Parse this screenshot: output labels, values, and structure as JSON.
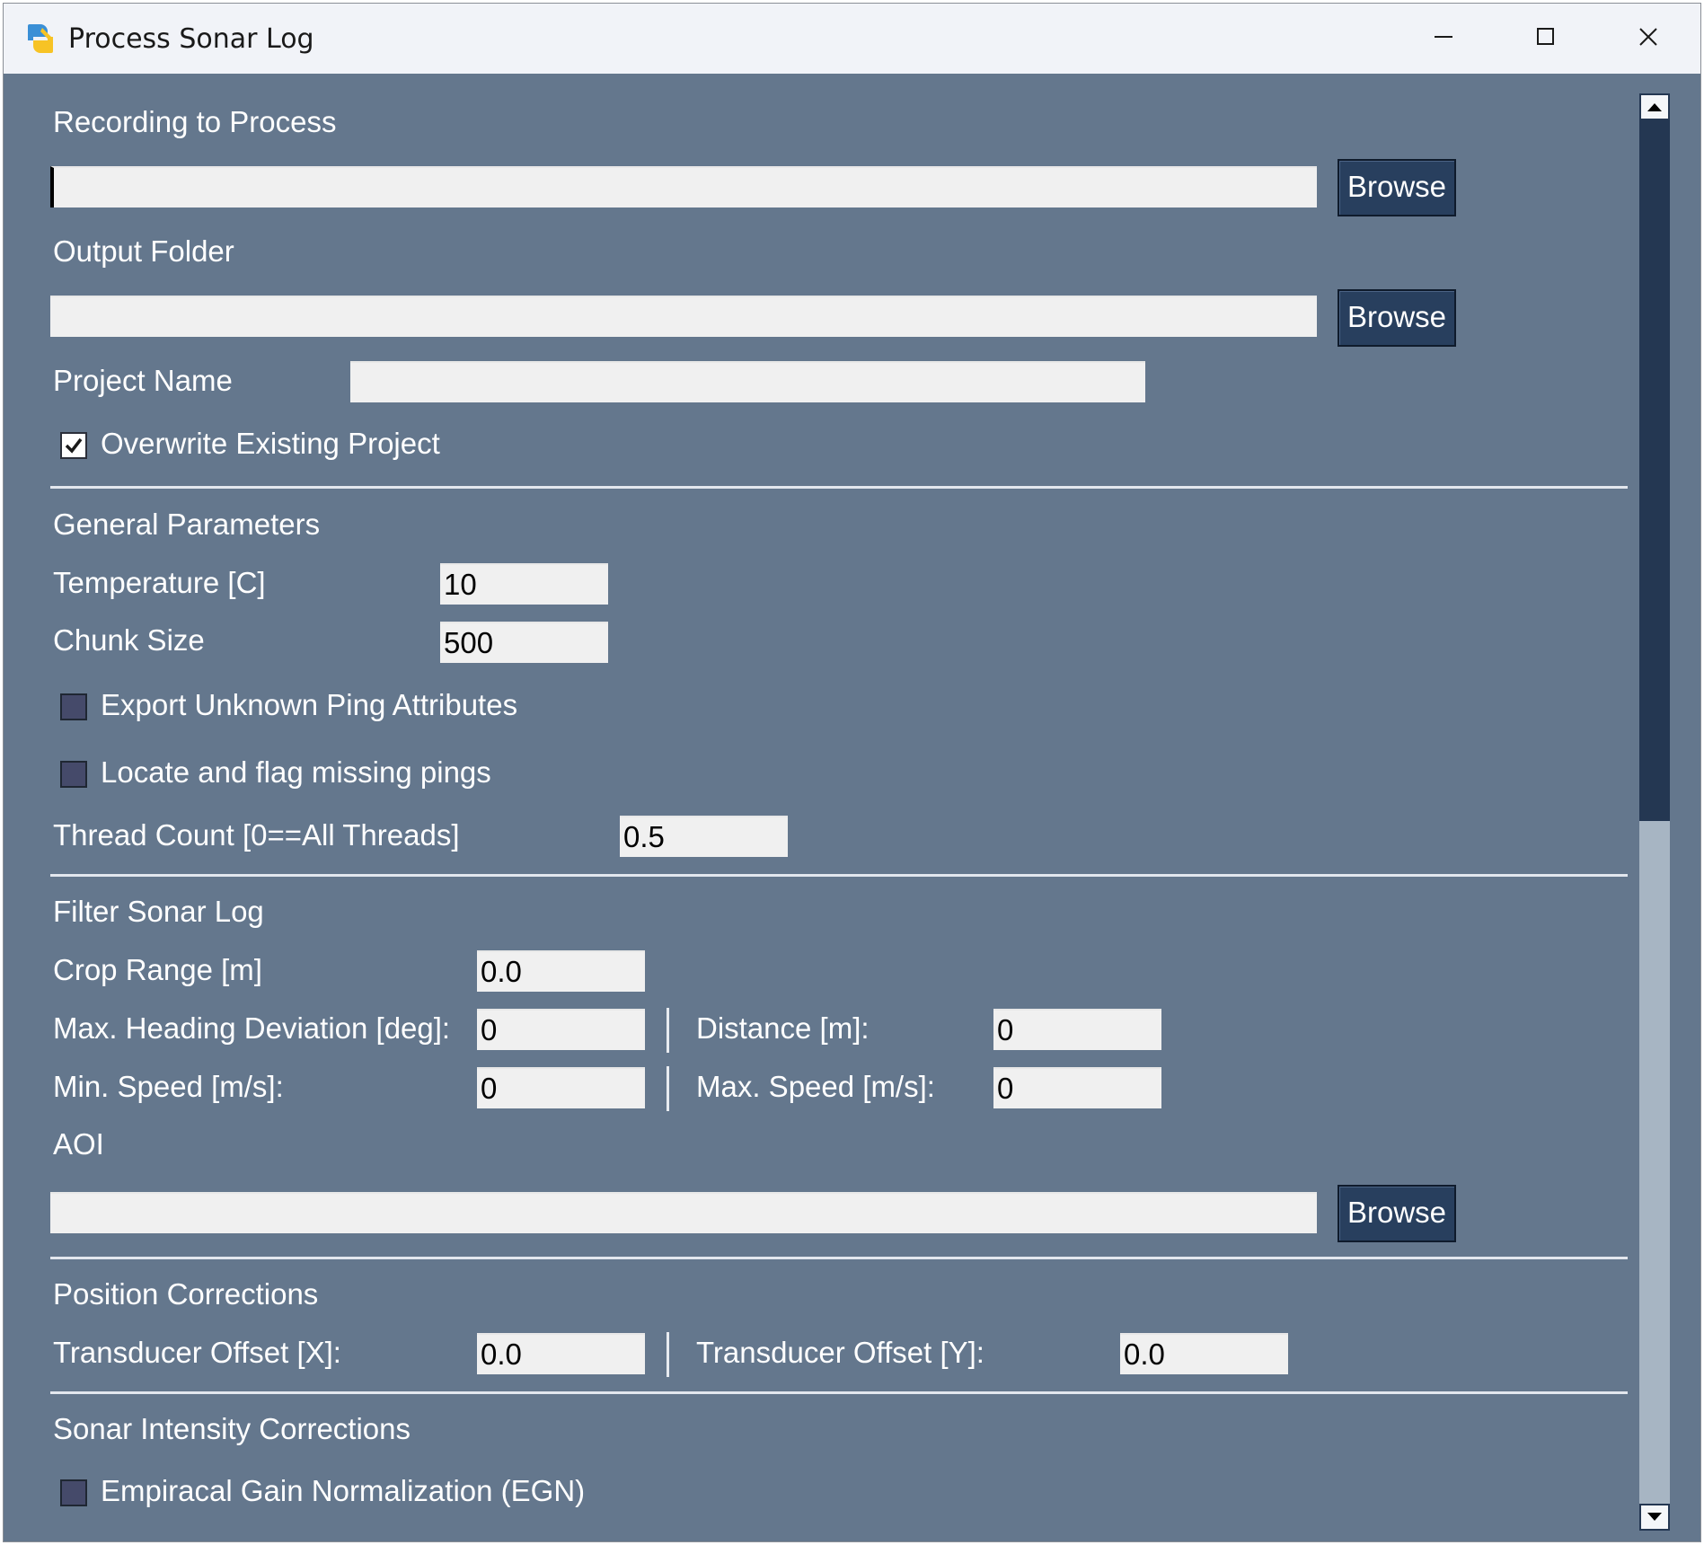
{
  "window": {
    "title": "Process Sonar Log"
  },
  "form": {
    "recording_label": "Recording to Process",
    "recording_value": "",
    "recording_browse": "Browse",
    "output_label": "Output Folder",
    "output_value": "",
    "output_browse": "Browse",
    "project_name_label": "Project Name",
    "project_name_value": "",
    "overwrite_label": "Overwrite Existing Project",
    "overwrite_checked": true
  },
  "general": {
    "heading": "General Parameters",
    "temperature_label": "Temperature [C]",
    "temperature_value": "10",
    "chunk_label": "Chunk Size",
    "chunk_value": "500",
    "export_unknown_label": "Export Unknown Ping Attributes",
    "export_unknown_checked": false,
    "locate_missing_label": "Locate and flag missing pings",
    "locate_missing_checked": false,
    "thread_label": "Thread Count [0==All Threads]",
    "thread_value": "0.5"
  },
  "filter": {
    "heading": "Filter Sonar Log",
    "crop_label": "Crop Range [m]",
    "crop_value": "0.0",
    "heading_dev_label": "Max. Heading Deviation [deg]:",
    "heading_dev_value": "0",
    "distance_label": "Distance [m]:",
    "distance_value": "0",
    "min_speed_label": "Min. Speed [m/s]:",
    "min_speed_value": "0",
    "max_speed_label": "Max. Speed [m/s]:",
    "max_speed_value": "0",
    "aoi_label": "AOI",
    "aoi_value": "",
    "aoi_browse": "Browse"
  },
  "position": {
    "heading": "Position Corrections",
    "offset_x_label": "Transducer Offset [X]:",
    "offset_x_value": "0.0",
    "offset_y_label": "Transducer Offset [Y]:",
    "offset_y_value": "0.0"
  },
  "intensity": {
    "heading": "Sonar Intensity Corrections",
    "egn_label": "Empiracal Gain Normalization (EGN)",
    "egn_checked": false
  },
  "icons": {
    "app": "python-icon",
    "minimize": "minimize-icon",
    "maximize": "maximize-icon",
    "close": "close-icon",
    "check": "checkmark-icon"
  },
  "colors": {
    "background": "#64778d",
    "button": "#283f5e",
    "titlebar": "#f1f3f8"
  }
}
